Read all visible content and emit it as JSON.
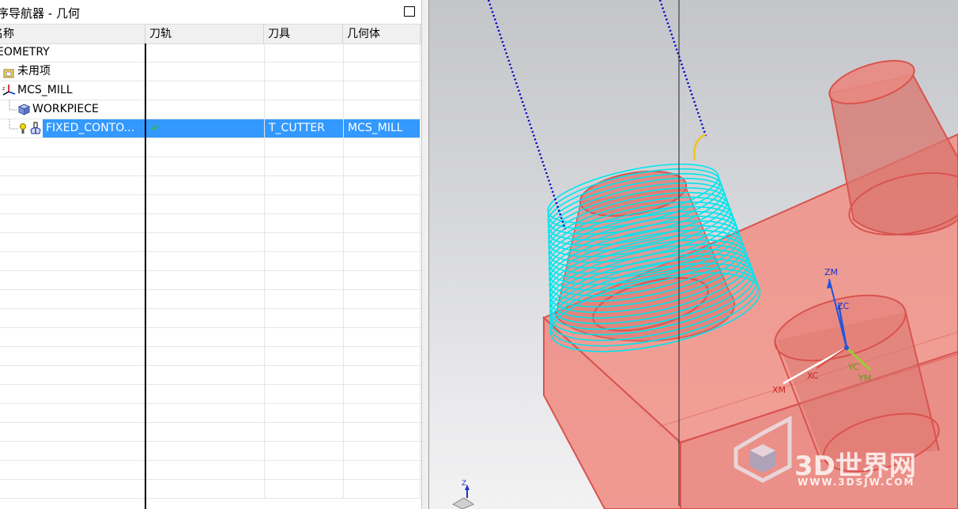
{
  "navigator": {
    "title": "序导航器 - 几何",
    "columns": {
      "name": "名称",
      "toolpath": "刀轨",
      "tool": "刀具",
      "geometry": "几何体"
    },
    "rows": [
      {
        "name": "EOMETRY",
        "toolpath": "",
        "tool": "",
        "geometry": "",
        "icon": ""
      },
      {
        "name": "未用项",
        "toolpath": "",
        "tool": "",
        "geometry": "",
        "icon": "folder-icon"
      },
      {
        "name": "MCS_MILL",
        "toolpath": "",
        "tool": "",
        "geometry": "",
        "icon": "mcs-axis-icon"
      },
      {
        "name": "WORKPIECE",
        "toolpath": "",
        "tool": "",
        "geometry": "",
        "icon": "workpiece-cube-icon"
      },
      {
        "name": "FIXED_CONTO...",
        "toolpath": "✔",
        "tool": "T_CUTTER",
        "geometry": "MCS_MILL",
        "icon": "operation-icon",
        "selected": true
      }
    ]
  },
  "viewport": {
    "axis_labels": {
      "zm": "ZM",
      "zc": "ZC",
      "xc": "XC",
      "xm": "XM",
      "yc": "YC",
      "ym": "YM",
      "z": "Z"
    },
    "colors": {
      "part": "#f08a80",
      "part_edge": "#d9534f",
      "toolpath": "#00e5ee",
      "approach": "#0000cc",
      "tool_arc": "#f0c419",
      "zm_axis": "#2255dd",
      "xm_axis": "#ffffff",
      "ym_axis": "#9acd32"
    }
  },
  "watermark": {
    "brand": "3D世界网",
    "url": "WWW.3DSJW.COM"
  },
  "icons": {
    "maximize": "maximize-icon",
    "check": "check-icon"
  }
}
